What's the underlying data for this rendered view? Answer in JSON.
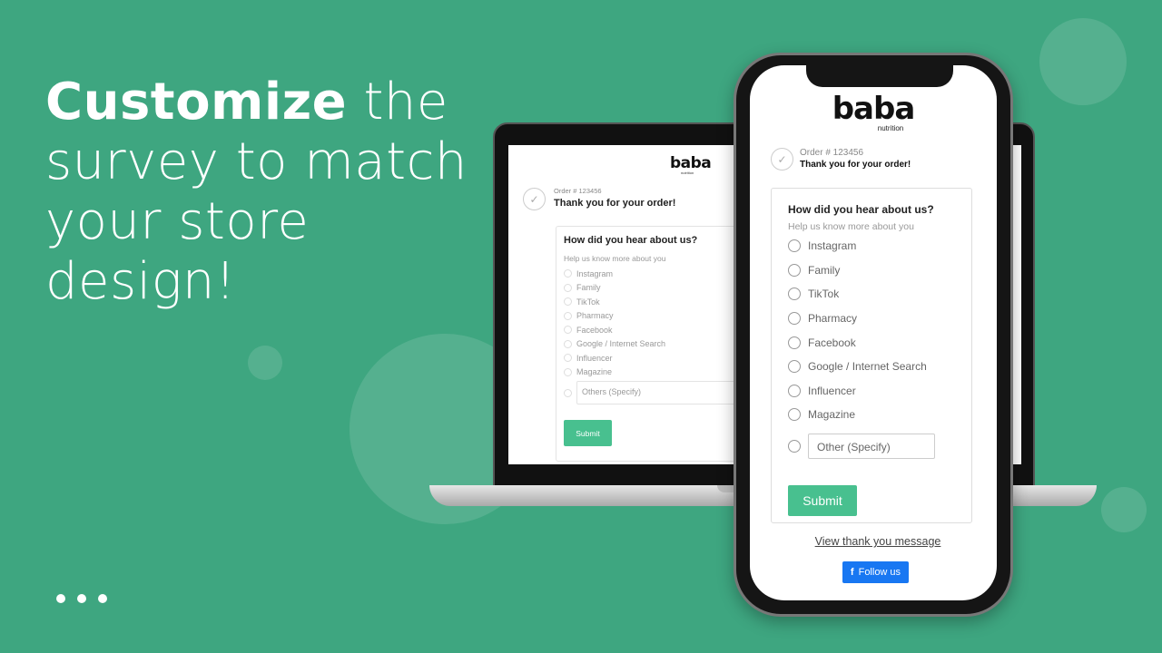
{
  "headline": {
    "bold": "Customize",
    "line1_rest": " the",
    "line2": "survey to match",
    "line3": "your store",
    "line4": "design!"
  },
  "colors": {
    "background": "#3ea680",
    "accent": "#48c08f",
    "facebook": "#1877f2"
  },
  "survey": {
    "brand": "baba",
    "brand_sub": "nutrition",
    "order": "Order # 123456",
    "thanks": "Thank you for your order!",
    "question": "How did you hear about us?",
    "help": "Help us know more about you",
    "options": [
      "Instagram",
      "Family",
      "TikTok",
      "Pharmacy",
      "Facebook",
      "Google / Internet Search",
      "Influencer",
      "Magazine"
    ],
    "laptop_other": "Others (Specify)",
    "phone_other": "Other (Specify)",
    "submit": "Submit",
    "view_link": "View thank you message",
    "follow": "Follow us",
    "follow_icon": "facebook-icon"
  }
}
